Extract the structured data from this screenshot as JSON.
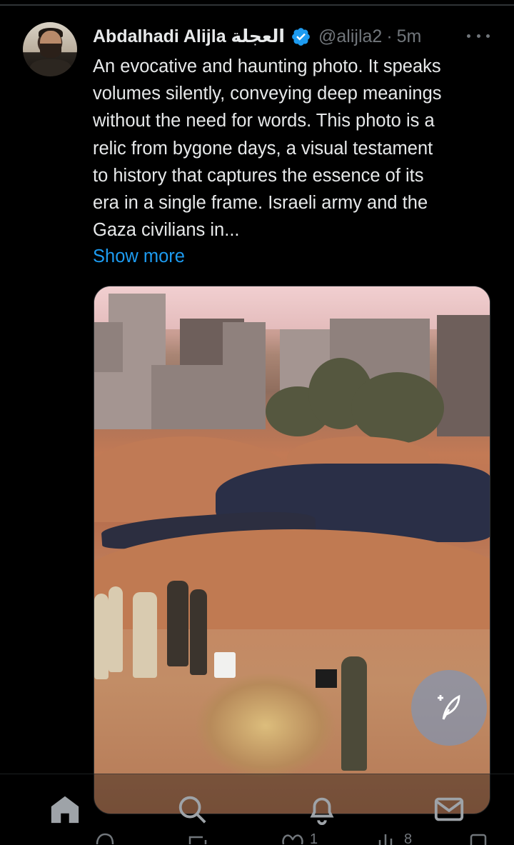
{
  "post": {
    "author_name": "Abdalhadi Alijla العجلة",
    "handle": "@alijla2",
    "separator": "·",
    "time": "5m",
    "verified": true,
    "text_lines": [
      "An evocative and haunting photo. It speaks",
      "volumes silently, conveying deep meanings",
      "without the need for words. This photo is a",
      "relic from bygone days, a visual testament",
      "to history that captures the essence of its",
      "era in a single frame. Israeli army and the",
      "Gaza civilians in..."
    ],
    "show_more_label": "Show more",
    "actions_peek": {
      "like_count": "1",
      "views_count": "8"
    }
  },
  "icons": {
    "more": "more-icon",
    "verified": "verified-badge-icon",
    "compose": "compose-feather-icon",
    "nav": [
      "home-icon",
      "search-icon",
      "notifications-icon",
      "messages-icon"
    ]
  },
  "colors": {
    "background": "#000000",
    "text": "#e7e9ea",
    "secondary_text": "#71767b",
    "accent": "#1d9bf0"
  }
}
